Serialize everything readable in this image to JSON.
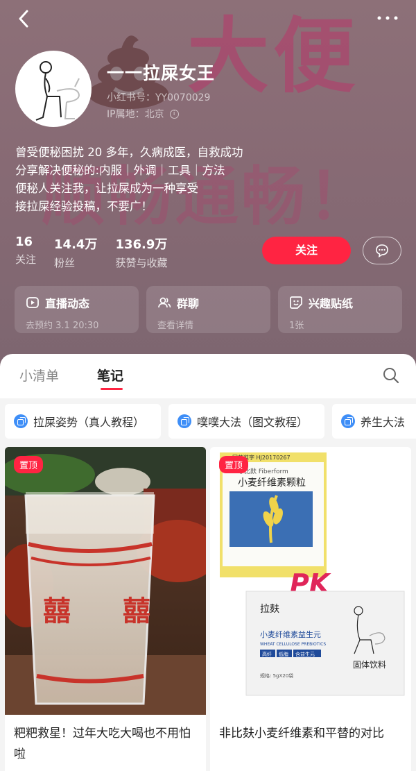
{
  "profile": {
    "nickname": "一一拉屎女王",
    "redbook_id": "小红书号：YY0070029",
    "ip": "IP属地：北京",
    "bio": [
      "曾受便秘困扰 20 多年，久病成医，自救成功",
      "分享解决便秘的:内服｜外调｜工具｜方法",
      "便秘人关注我，让拉屎成为一种享受",
      "接拉屎经验投稿，不要广！"
    ],
    "background_text": {
      "big": "大便",
      "banner": "顺畅通畅！"
    }
  },
  "stats": [
    {
      "num": "16",
      "label": "关注"
    },
    {
      "num": "14.4万",
      "label": "粉丝"
    },
    {
      "num": "136.9万",
      "label": "获赞与收藏"
    }
  ],
  "actions": {
    "follow_label": "关注"
  },
  "feature_cards": [
    {
      "title": "直播动态",
      "subtitle": "去预约 3.1 20:30",
      "icon": "live-icon"
    },
    {
      "title": "群聊",
      "subtitle": "查看详情",
      "icon": "group-chat-icon"
    },
    {
      "title": "兴趣贴纸",
      "subtitle": "1张",
      "icon": "sticker-icon"
    }
  ],
  "tabs": [
    {
      "label": "小清单",
      "active": false
    },
    {
      "label": "笔记",
      "active": true
    }
  ],
  "collections": [
    {
      "label": "拉屎姿势（真人教程）"
    },
    {
      "label": "噗噗大法（图文教程）"
    },
    {
      "label": "养生大法"
    }
  ],
  "notes": [
    {
      "badge": "置顶",
      "title": "粑粑救星！过年大吃大喝也不用怕啦",
      "image_text": {
        "glass_char": "囍"
      }
    },
    {
      "badge": "置顶",
      "title": "非比麸小麦纤维素和平替的对比",
      "image_text": {
        "box1_top": "国药准字 HJ20170267",
        "box1_brand": "非比麸 Fiberform",
        "box1_name": "小麦纤维素颗粒",
        "pk": "PK",
        "box2_brand": "拉麸",
        "box2_name": "小麦纤维素益生元",
        "box2_sub": "WHEAT CELLULOSE PREBIOTICS",
        "box2_tags": [
          "高纤",
          "低脂",
          "含益生元"
        ],
        "box2_type": "固体饮料",
        "box2_spec": "规格: 5gX20袋"
      }
    }
  ],
  "colors": {
    "accent": "#ff2442",
    "header_bg": "#876a74",
    "chip_icon": "#3e8ef7"
  }
}
